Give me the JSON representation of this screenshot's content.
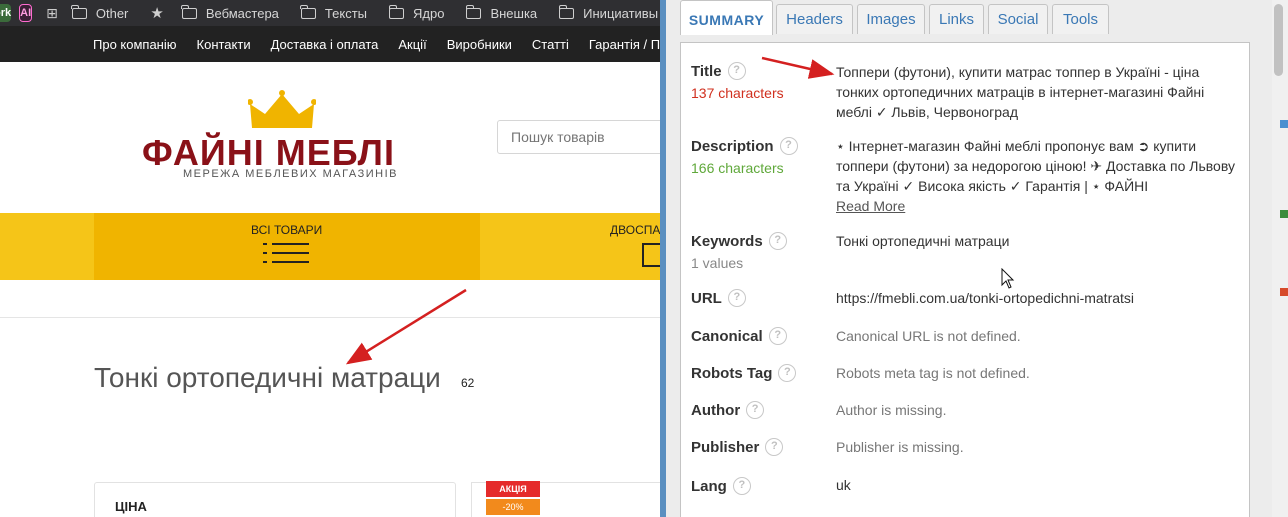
{
  "browser": {
    "bookmarks": {
      "work_label": "ork",
      "ai_label": "AI",
      "folders": [
        "Other",
        "Вебмастера",
        "Тексты",
        "Ядро",
        "Внешка",
        "Инициативы"
      ]
    }
  },
  "site": {
    "topnav": [
      "Про компанію",
      "Контакти",
      "Доставка і оплата",
      "Акції",
      "Виробники",
      "Статті",
      "Гарантія / П"
    ],
    "logo": {
      "name": "ФАЙНІ МЕБЛІ",
      "tagline": "МЕРЕЖА МЕБЛЕВИХ МАГАЗИНІВ"
    },
    "search": {
      "placeholder": "Пошук товарів"
    },
    "categories": {
      "all_label": "ВСІ ТОВАРИ",
      "second_label": "ДВОСПА"
    },
    "page_title": "Тонкі ортопедичні матраци",
    "product_count": "62",
    "filter": {
      "title": "ЦІНА"
    },
    "badges": {
      "sale": "АКЦІЯ",
      "discount": "-20%"
    }
  },
  "extension": {
    "tabs": [
      "SUMMARY",
      "Headers",
      "Images",
      "Links",
      "Social",
      "Tools"
    ],
    "active_tab": "SUMMARY",
    "help_glyph": "?",
    "title": {
      "label": "Title",
      "meta": "137 characters",
      "value": "Топпери (футони), купити матрас топпер в Україні - ціна тонких ортопедичних матраців в інтернет-магазині Файні меблі ✓ Львів, Червоноград"
    },
    "description": {
      "label": "Description",
      "meta": "166 characters",
      "value": "⋆ Інтернет-магазин Файні меблі пропонує вам ➲ купити топпери (футони) за недорогою ціною! ✈ Доставка по Львову та Україні ✓ Висока якість ✓ Гарантія | ⋆ ФАЙНІ",
      "read_more": "Read More"
    },
    "keywords": {
      "label": "Keywords",
      "meta": "1 values",
      "value": "Тонкі ортопедичні матраци"
    },
    "url": {
      "label": "URL",
      "value": "https://fmebli.com.ua/tonki-ortopedichni-matratsi"
    },
    "canonical": {
      "label": "Canonical",
      "value": "Canonical URL is not defined."
    },
    "robots": {
      "label": "Robots Tag",
      "value": "Robots meta tag is not defined."
    },
    "author": {
      "label": "Author",
      "value": "Author is missing."
    },
    "publisher": {
      "label": "Publisher",
      "value": "Publisher is missing."
    },
    "lang": {
      "label": "Lang",
      "value": "uk"
    }
  },
  "colors": {
    "brand_red": "#8a1118",
    "crown_gold": "#f0b400",
    "catbar_yellow": "#f5c518",
    "ext_accent": "#3a78b5",
    "meta_red": "#d0301f",
    "meta_green": "#5fa83a",
    "arrow_red": "#d42020"
  }
}
